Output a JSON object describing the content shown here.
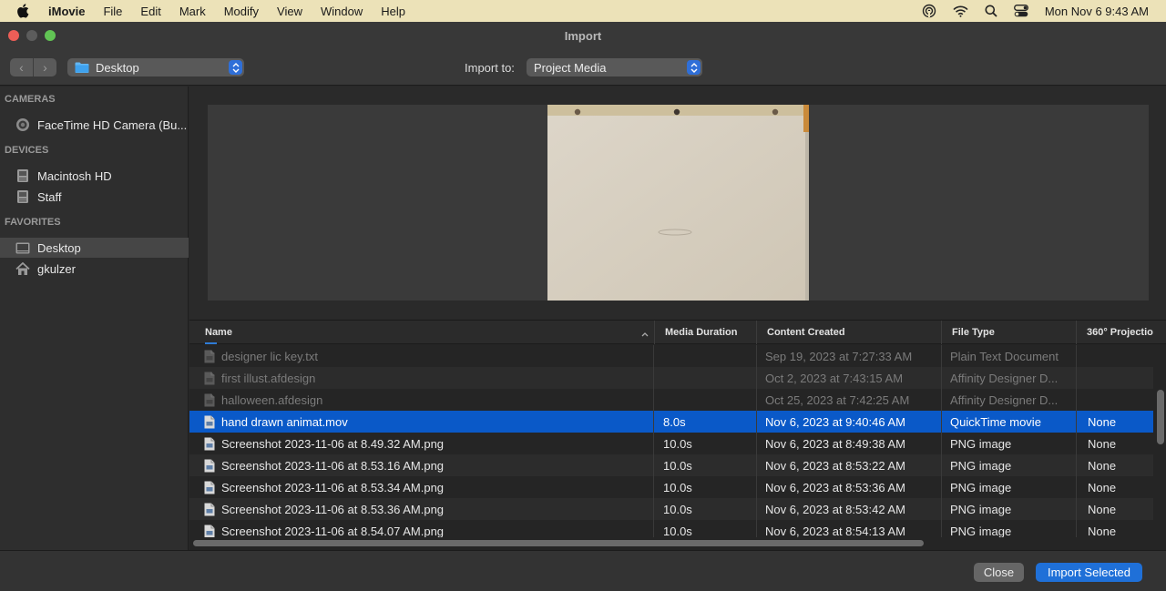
{
  "menubar": {
    "app": "iMovie",
    "items": [
      "File",
      "Edit",
      "Mark",
      "Modify",
      "View",
      "Window",
      "Help"
    ],
    "clock": "Mon Nov 6  9:43 AM",
    "status_icons": [
      "airdrop-icon",
      "wifi-icon",
      "search-icon",
      "control-center-icon"
    ],
    "bg_color": "#ece2b8"
  },
  "window": {
    "title": "Import"
  },
  "toolbar": {
    "back_glyph": "‹",
    "forward_glyph": "›",
    "location": "Desktop",
    "import_to_label": "Import to:",
    "destination": "Project Media"
  },
  "sidebar": {
    "sections": [
      {
        "title": "CAMERAS",
        "items": [
          {
            "label": "FaceTime HD Camera (Bu...",
            "icon": "camera-icon",
            "selected": false
          }
        ]
      },
      {
        "title": "DEVICES",
        "items": [
          {
            "label": "Macintosh HD",
            "icon": "hard-drive-icon",
            "selected": false
          },
          {
            "label": "Staff",
            "icon": "hard-drive-icon",
            "selected": false
          }
        ]
      },
      {
        "title": "FAVORITES",
        "items": [
          {
            "label": "Desktop",
            "icon": "desktop-folder-icon",
            "selected": true
          },
          {
            "label": "gkulzer",
            "icon": "home-icon",
            "selected": false
          }
        ]
      }
    ]
  },
  "table": {
    "columns": [
      "Name",
      "Media Duration",
      "Content Created",
      "File Type",
      "360° Projectio"
    ],
    "sort_column": "Name",
    "rows": [
      {
        "name": "designer lic key.txt",
        "duration": "",
        "created": "Sep 19, 2023 at 7:27:33 AM",
        "type": "Plain Text Document",
        "projection": "",
        "state": "dim"
      },
      {
        "name": "first illust.afdesign",
        "duration": "",
        "created": "Oct 2, 2023 at 7:43:15 AM",
        "type": "Affinity Designer D...",
        "projection": "",
        "state": "dim"
      },
      {
        "name": "halloween.afdesign",
        "duration": "",
        "created": "Oct 25, 2023 at 7:42:25 AM",
        "type": "Affinity Designer D...",
        "projection": "",
        "state": "dim"
      },
      {
        "name": "hand drawn animat.mov",
        "duration": "8.0s",
        "created": "Nov 6, 2023 at 9:40:46 AM",
        "type": "QuickTime movie",
        "projection": "None",
        "state": "selected"
      },
      {
        "name": "Screenshot 2023-11-06 at 8.49.32 AM.png",
        "duration": "10.0s",
        "created": "Nov 6, 2023 at 8:49:38 AM",
        "type": "PNG image",
        "projection": "None",
        "state": "normal"
      },
      {
        "name": "Screenshot 2023-11-06 at 8.53.16 AM.png",
        "duration": "10.0s",
        "created": "Nov 6, 2023 at 8:53:22 AM",
        "type": "PNG image",
        "projection": "None",
        "state": "normal"
      },
      {
        "name": "Screenshot 2023-11-06 at 8.53.34 AM.png",
        "duration": "10.0s",
        "created": "Nov 6, 2023 at 8:53:36 AM",
        "type": "PNG image",
        "projection": "None",
        "state": "normal"
      },
      {
        "name": "Screenshot 2023-11-06 at 8.53.36 AM.png",
        "duration": "10.0s",
        "created": "Nov 6, 2023 at 8:53:42 AM",
        "type": "PNG image",
        "projection": "None",
        "state": "normal"
      },
      {
        "name": "Screenshot 2023-11-06 at 8.54.07 AM.png",
        "duration": "10.0s",
        "created": "Nov 6, 2023 at 8:54:13 AM",
        "type": "PNG image",
        "projection": "None",
        "state": "normal"
      }
    ]
  },
  "footer": {
    "close_label": "Close",
    "import_label": "Import Selected"
  },
  "colors": {
    "accent": "#0a59c8",
    "button_primary": "#1f70d8"
  }
}
